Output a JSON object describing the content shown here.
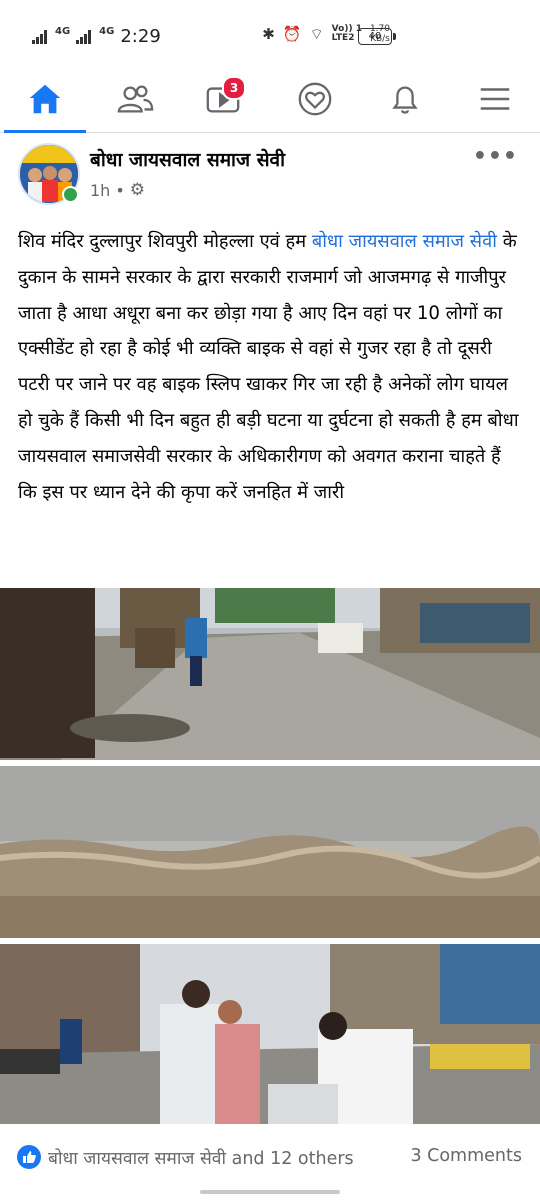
{
  "status_bar": {
    "network1": "4G",
    "network2": "4G",
    "time": "2:29",
    "volte": "Vo)) 1",
    "lte": "LTE2",
    "speed_value": "1.70",
    "speed_unit": "KB/s",
    "battery": "40"
  },
  "tabs": [
    {
      "id": "home",
      "active": true
    },
    {
      "id": "friends",
      "active": false
    },
    {
      "id": "watch",
      "active": false,
      "badge": "3"
    },
    {
      "id": "dating",
      "active": false
    },
    {
      "id": "notifications",
      "active": false
    },
    {
      "id": "menu",
      "active": false
    }
  ],
  "post": {
    "page_name": "बोधा जायसवाल समाज सेवी",
    "time": "1h",
    "separator": "•",
    "more": "•••",
    "text_before_link": "शिव मंदिर दुल्लापुर शिवपुरी मोहल्ला एवं हम ",
    "text_link": "बोधा जायसवाल समाज सेवी",
    "text_after_link": " के दुकान के सामने सरकार के द्वारा सरकारी राजमार्ग जो आजमगढ़ से गाजीपुर जाता है आधा अधूरा बना कर छोड़ा गया है आए दिन वहां पर 10 लोगों का एक्सीडेंट हो रहा है कोई भी व्यक्ति बाइक से वहां से गुजर रहा है तो दूसरी पटरी पर जाने पर वह बाइक स्लिप खाकर गिर जा रही है अनेकों लोग घायल हो चुके हैं किसी भी दिन बहुत ही बड़ी घटना या दुर्घटना हो सकती है हम बोधा जायसवाल समाजसेवी सरकार के अधिकारीगण को अवगत कराना चाहते हैं कि इस पर ध्यान देने की कृपा करें जनहित में जारी"
  },
  "reactions": {
    "likes": "बोधा जायसवाल समाज सेवी and 12 others",
    "comments": "3 Comments"
  },
  "colors": {
    "accent": "#1877f2",
    "link": "#216fdb",
    "badge": "#e41e3f",
    "secondary_text": "#65676b"
  }
}
